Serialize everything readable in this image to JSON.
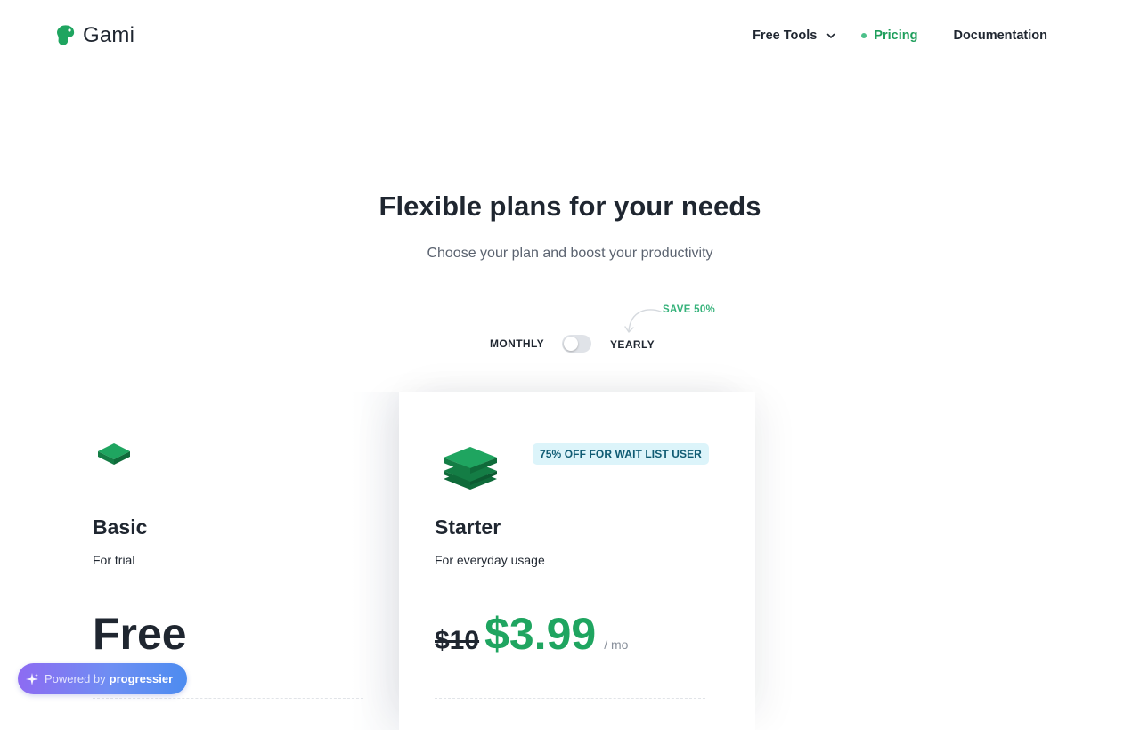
{
  "brand": {
    "name": "Gami",
    "color": "#1fa560"
  },
  "nav": {
    "free_tools": "Free Tools",
    "pricing": "Pricing",
    "documentation": "Documentation"
  },
  "hero": {
    "title": "Flexible plans for your needs",
    "subtitle": "Choose your plan and boost your productivity"
  },
  "billing": {
    "monthly": "MONTHLY",
    "yearly": "YEARLY",
    "save": "SAVE 50%",
    "yearly_selected": false
  },
  "plans": [
    {
      "name": "Basic",
      "desc": "For trial",
      "price": "Free"
    },
    {
      "name": "Starter",
      "desc": "For everyday usage",
      "badge": "75% OFF FOR WAIT LIST USER",
      "old_price": "$10",
      "price": "$3.99",
      "unit": "/ mo"
    }
  ],
  "powered": {
    "prefix": "Powered by",
    "brand": "progressier"
  },
  "icons": [
    "gami-logo-icon",
    "chevron-down-icon",
    "active-dot-icon",
    "curved-arrow-icon",
    "plan-single-layer-icon",
    "plan-stack-icon",
    "sparkle-icon"
  ]
}
